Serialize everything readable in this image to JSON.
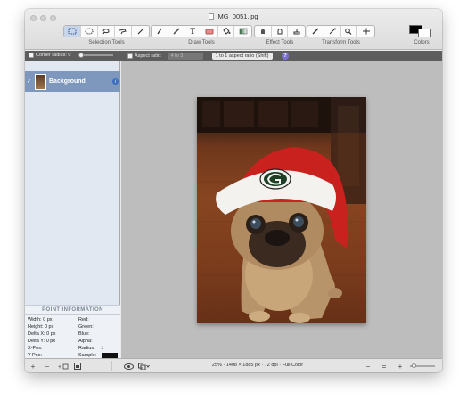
{
  "window": {
    "title": "IMG_0051.jpg"
  },
  "toolbar": {
    "groups": [
      {
        "label": "Selection Tools",
        "tools": [
          "rectangular-selection",
          "elliptical-selection",
          "lasso-selection",
          "smart-lasso-selection",
          "instant-alpha"
        ]
      },
      {
        "label": "Draw Tools",
        "tools": [
          "sketch",
          "draw",
          "text",
          "eraser",
          "fill",
          "gradient"
        ]
      },
      {
        "label": "Effect Tools",
        "tools": [
          "burn",
          "dodge",
          "clone"
        ]
      },
      {
        "label": "Transform Tools",
        "tools": [
          "color-picker",
          "magic-wand",
          "zoom",
          "move"
        ]
      }
    ],
    "colors_label": "Colors",
    "foreground_color": "#000000",
    "background_color": "#ffffff"
  },
  "options": {
    "corner_radius_label": "Corner radius: 0",
    "aspect_ratio_label": "Aspect ratio:",
    "aspect_ratio_value": "4 to 3",
    "aspect_preset": "1 to 1 aspect ratio (Shift)",
    "help": "?"
  },
  "layers": [
    {
      "name": "Background",
      "visible_mark": "✓",
      "info": "i"
    }
  ],
  "point_info": {
    "title": "POINT INFORMATION",
    "rows": [
      {
        "label": "Width:",
        "value": "0 px",
        "label2": "Red:",
        "value2": ""
      },
      {
        "label": "Height:",
        "value": "0 px",
        "label2": "Green:",
        "value2": ""
      },
      {
        "label": "Delta X:",
        "value": "0 px",
        "label2": "Blue:",
        "value2": ""
      },
      {
        "label": "Delta Y:",
        "value": "0 px",
        "label2": "Alpha:",
        "value2": ""
      },
      {
        "label": "X-Pos:",
        "value": "",
        "label2": "Radius:",
        "value2": "1"
      },
      {
        "label": "Y-Pos:",
        "value": "",
        "label2": "Sample:",
        "value2": ""
      }
    ]
  },
  "status": {
    "text": "25% · 1408 × 1885 px · 72 dpi · Full Color",
    "add": "+",
    "remove": "−",
    "zoom_out": "−",
    "zoom_fit": "=",
    "zoom_in": "+"
  },
  "colors": {
    "selection_blue": "#7d97bd",
    "sidebar_bg": "#e1e8f1",
    "canvas_bg": "#bdbdbd"
  }
}
